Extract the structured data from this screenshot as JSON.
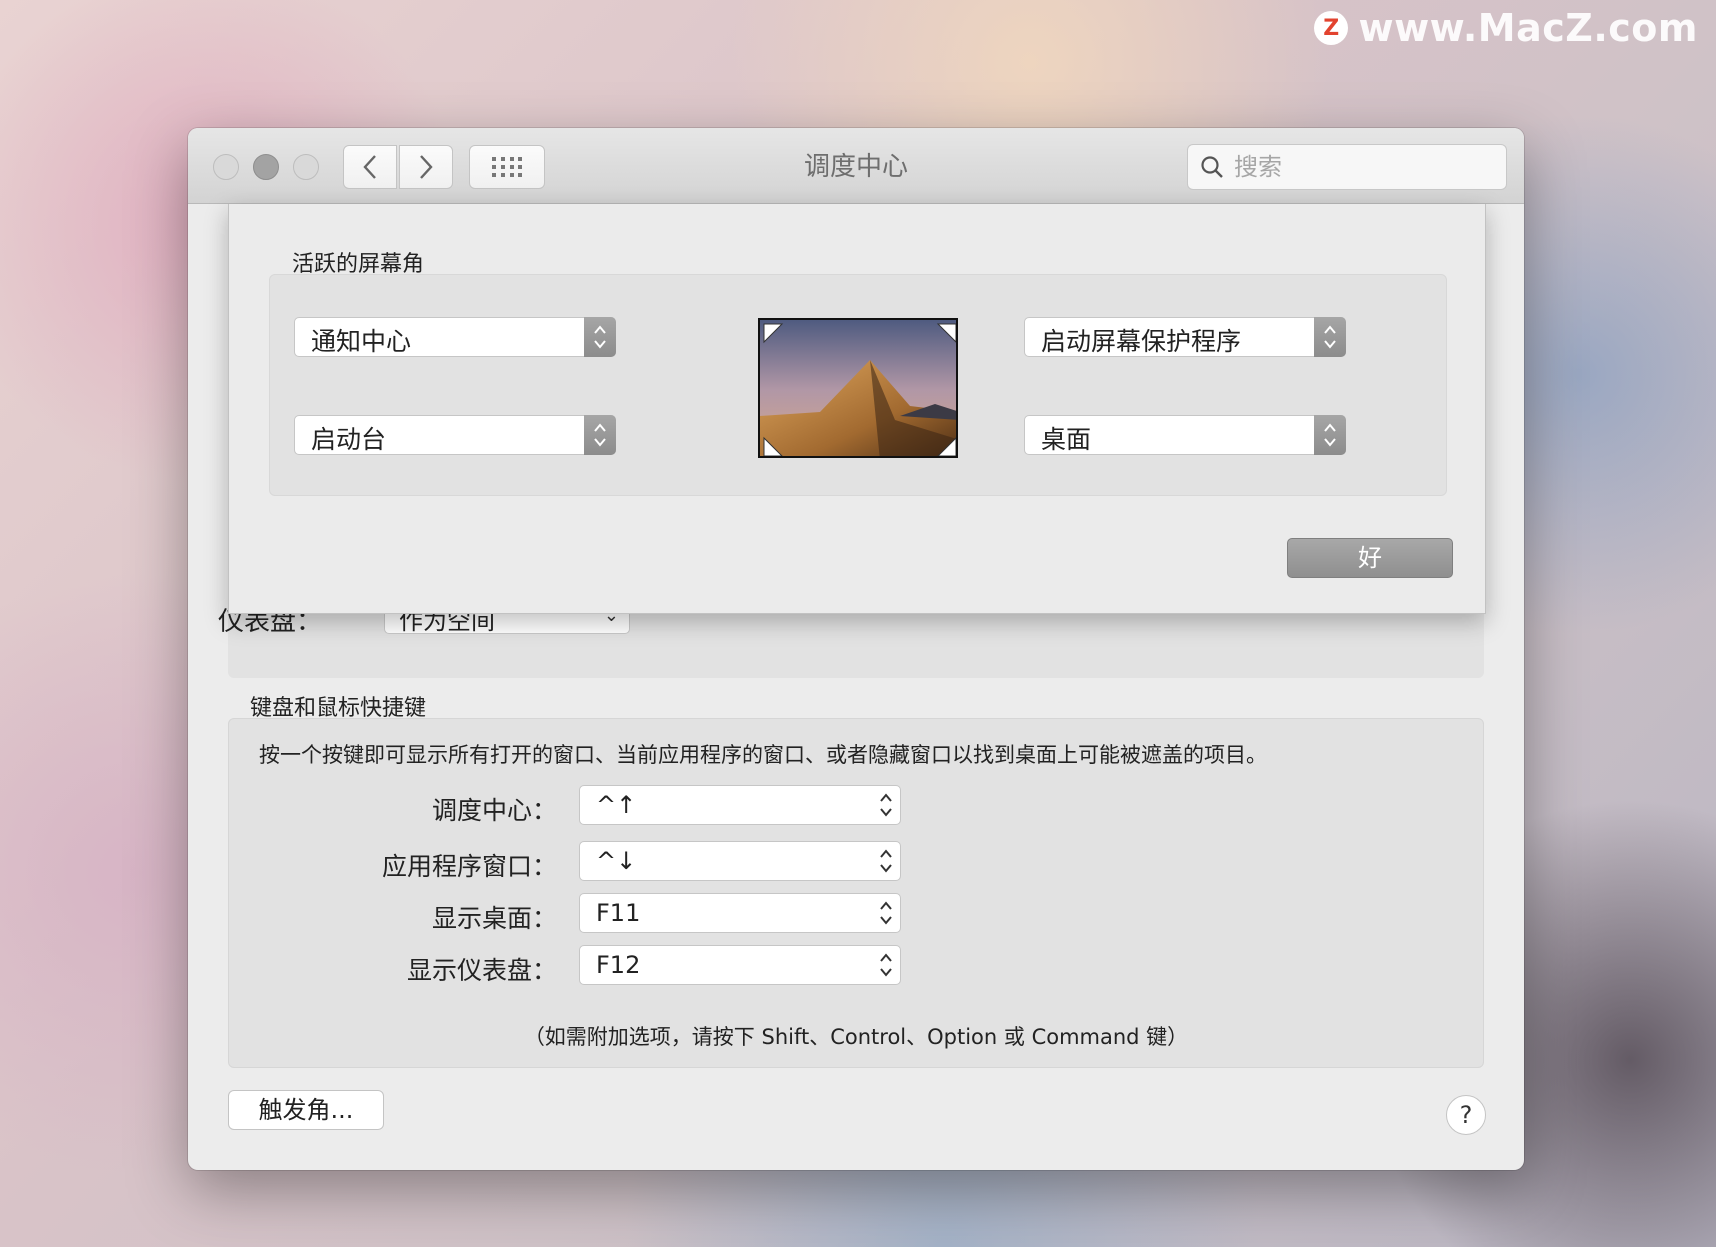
{
  "watermark": {
    "logo": "Z",
    "text": "www.MacZ.com"
  },
  "window": {
    "title": "调度中心"
  },
  "search": {
    "placeholder": "搜索"
  },
  "sheet": {
    "title": "活跃的屏幕角",
    "top_left": "通知中心",
    "bottom_left": "启动台",
    "top_right": "启动屏幕保护程序",
    "bottom_right": "桌面",
    "ok_label": "好"
  },
  "dashboard": {
    "label": "仪表盘：",
    "value": "作为空间"
  },
  "keyboard": {
    "title": "键盘和鼠标快捷键",
    "description": "按一个按键即可显示所有打开的窗口、当前应用程序的窗口、或者隐藏窗口以找到桌面上可能被遮盖的项目。",
    "rows": [
      {
        "label": "调度中心：",
        "value": "^↑"
      },
      {
        "label": "应用程序窗口：",
        "value": "^↓"
      },
      {
        "label": "显示桌面：",
        "value": "F11"
      },
      {
        "label": "显示仪表盘：",
        "value": "F12"
      }
    ],
    "note": "（如需附加选项，请按下 Shift、Control、Option 或 Command 键）"
  },
  "footer": {
    "hot_corners_label": "触发角...",
    "help_label": "?"
  }
}
